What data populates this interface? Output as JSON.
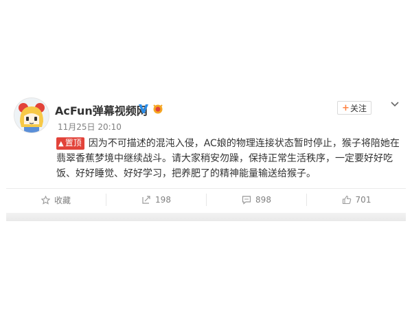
{
  "post": {
    "username": "AcFun弹幕视频网",
    "timestamp": "11月25日 20:10",
    "pin_label": "置顶",
    "text": "因为不可描述的混沌入侵，AC娘的物理连接状态暂时停止，猴子将陪她在翡翠香蕉梦境中继续战斗。请大家稍安勿躁，保持正常生活秩序，一定要好好吃饭、好好睡觉、好好学习，把养肥了的精神能量输送给猴子。"
  },
  "header": {
    "follow_label": "关注"
  },
  "actions": {
    "favorite_label": "收藏",
    "repost_count": "198",
    "comment_count": "898",
    "like_count": "701"
  },
  "colors": {
    "pin_red": "#e2433a",
    "verified_blue": "#2b8ce6",
    "follow_plus": "#ff8140",
    "muted_text": "#808080"
  },
  "icons": [
    "verified-icon",
    "vip-icon",
    "chevron-down-icon",
    "star-icon",
    "repost-icon",
    "comment-icon",
    "thumbs-up-icon",
    "pin-icon"
  ]
}
